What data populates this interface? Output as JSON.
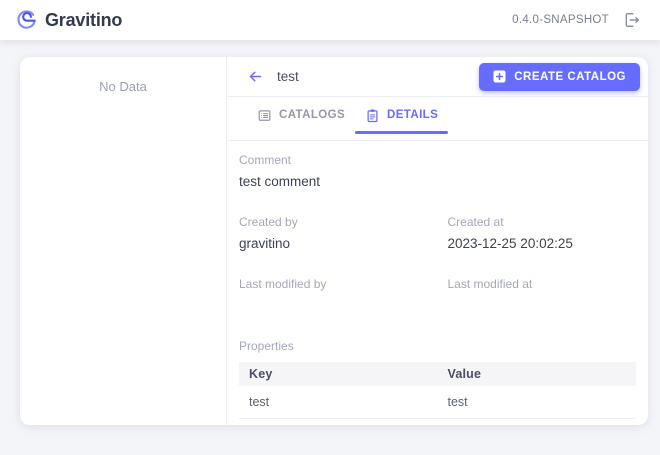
{
  "app_bar": {
    "brand": "Gravitino",
    "version": "0.4.0-SNAPSHOT"
  },
  "tree_panel": {
    "empty_text": "No Data"
  },
  "detail_panel": {
    "title": "test",
    "create_button_label": "CREATE CATALOG",
    "tabs": [
      {
        "label": "CATALOGS",
        "icon": "list-box-icon",
        "active": false
      },
      {
        "label": "DETAILS",
        "icon": "clipboard-icon",
        "active": true
      }
    ],
    "fields": {
      "comment": {
        "label": "Comment",
        "value": "test comment"
      },
      "created_by": {
        "label": "Created by",
        "value": "gravitino"
      },
      "created_at": {
        "label": "Created at",
        "value": "2023-12-25 20:02:25"
      },
      "last_modified_by": {
        "label": "Last modified by",
        "value": ""
      },
      "last_modified_at": {
        "label": "Last modified at",
        "value": ""
      }
    },
    "properties": {
      "label": "Properties",
      "columns": [
        "Key",
        "Value"
      ],
      "rows": [
        {
          "key": "test",
          "value": "test"
        }
      ]
    }
  },
  "colors": {
    "primary": "#666CFF",
    "page_background": "#f4f5f9",
    "card_background": "#ffffff",
    "text_primary": "#4c4e64",
    "text_label": "#a5a7ba"
  }
}
